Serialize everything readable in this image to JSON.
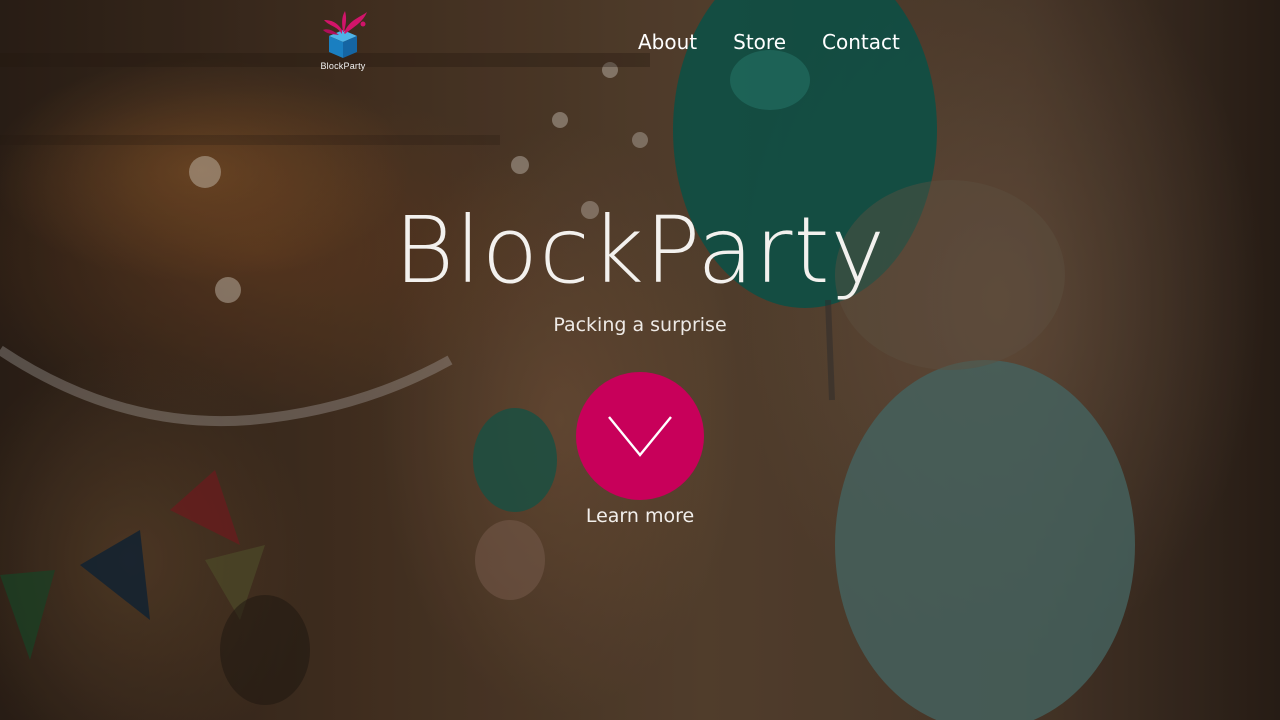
{
  "brand": {
    "logo_text": "BlockParty",
    "logo_icon": "gift-box-splash-icon"
  },
  "nav": {
    "items": [
      {
        "label": "About"
      },
      {
        "label": "Store"
      },
      {
        "label": "Contact"
      }
    ]
  },
  "hero": {
    "title": "BlockParty",
    "subtitle": "Packing a surprise",
    "cta_icon": "chevron-down-icon",
    "cta_label": "Learn more",
    "cta_color": "#c8005a"
  },
  "colors": {
    "accent": "#c8005a",
    "logo_box": "#1e88c7",
    "text": "#ffffff"
  }
}
